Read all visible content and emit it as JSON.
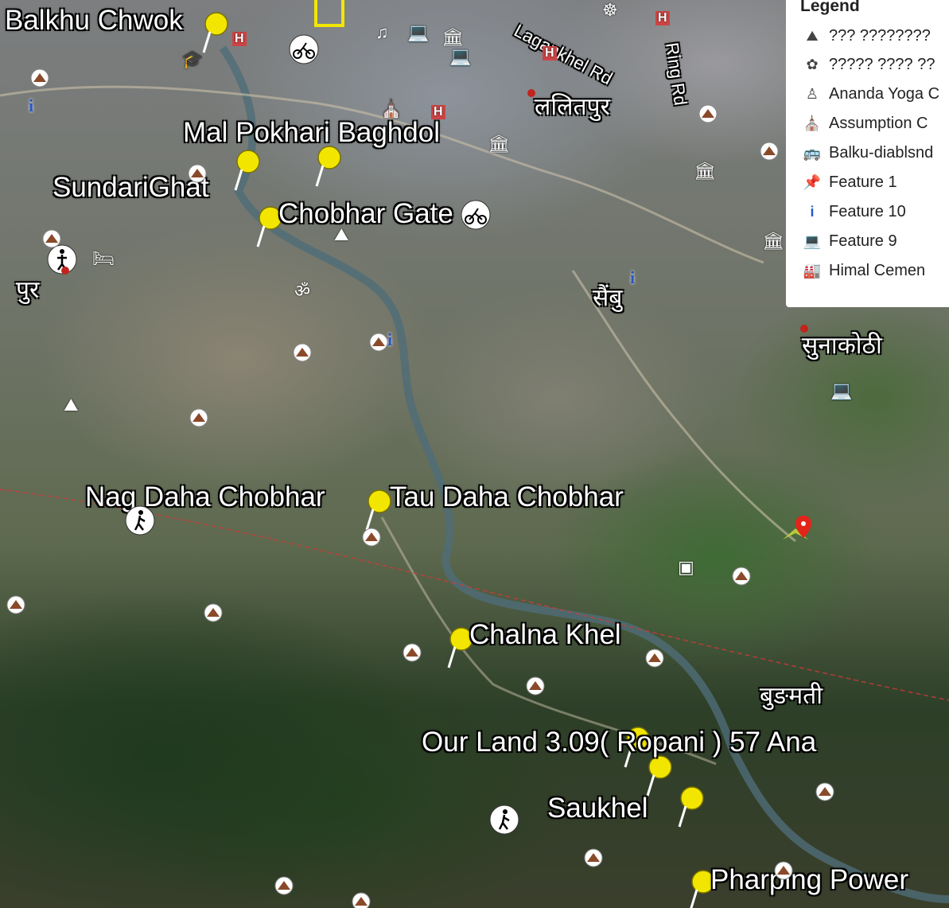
{
  "map": {
    "place_labels": [
      {
        "id": "balkhu",
        "text": "Balkhu Chwok"
      },
      {
        "id": "malpokhari",
        "text": "Mal Pokhari Baghdol"
      },
      {
        "id": "sundarighat",
        "text": "SundariGhat"
      },
      {
        "id": "chobhargate",
        "text": "Chobhar Gate"
      },
      {
        "id": "nagdaha",
        "text": "Nag Daha Chobhar"
      },
      {
        "id": "taudaha",
        "text": "Tau Daha Chobhar"
      },
      {
        "id": "chalnakhel",
        "text": "Chalna Khel"
      },
      {
        "id": "ourland",
        "text": "Our Land 3.09( Ropani ) 57 Ana"
      },
      {
        "id": "saukhel",
        "text": "Saukhel"
      },
      {
        "id": "pharping",
        "text": "Pharping Power"
      }
    ],
    "devanagari_labels": [
      {
        "id": "lalitpur",
        "text": "ललितपुर"
      },
      {
        "id": "sainbu",
        "text": "सैंबु"
      },
      {
        "id": "sunakothi",
        "text": "सुनाकोठी"
      },
      {
        "id": "bungmati",
        "text": "बुङमती"
      },
      {
        "id": "pur",
        "text": "पुर"
      }
    ],
    "road_labels": [
      {
        "id": "lagankhel",
        "text": "Lagankhel Rd"
      },
      {
        "id": "ringrd",
        "text": "Ring Rd"
      }
    ]
  },
  "legend": {
    "title": "Legend",
    "items": [
      {
        "icon": "hill-icon",
        "label": "??? ????????"
      },
      {
        "icon": "flower-icon",
        "label": "????? ???? ??"
      },
      {
        "icon": "yoga-icon",
        "label": "Ananda Yoga C"
      },
      {
        "icon": "church-icon",
        "label": "Assumption C"
      },
      {
        "icon": "bus-icon",
        "label": "Balku-diablsnd"
      },
      {
        "icon": "pushpin-icon",
        "label": "Feature 1"
      },
      {
        "icon": "info-icon",
        "label": "Feature 10"
      },
      {
        "icon": "laptop-icon",
        "label": "Feature 9"
      },
      {
        "icon": "factory-icon",
        "label": "Himal Cemen"
      }
    ]
  },
  "colors": {
    "pin": "#f2e600",
    "marker_red": "#e3241b",
    "water": "#4f6d78",
    "road": "#c9c0a8"
  }
}
